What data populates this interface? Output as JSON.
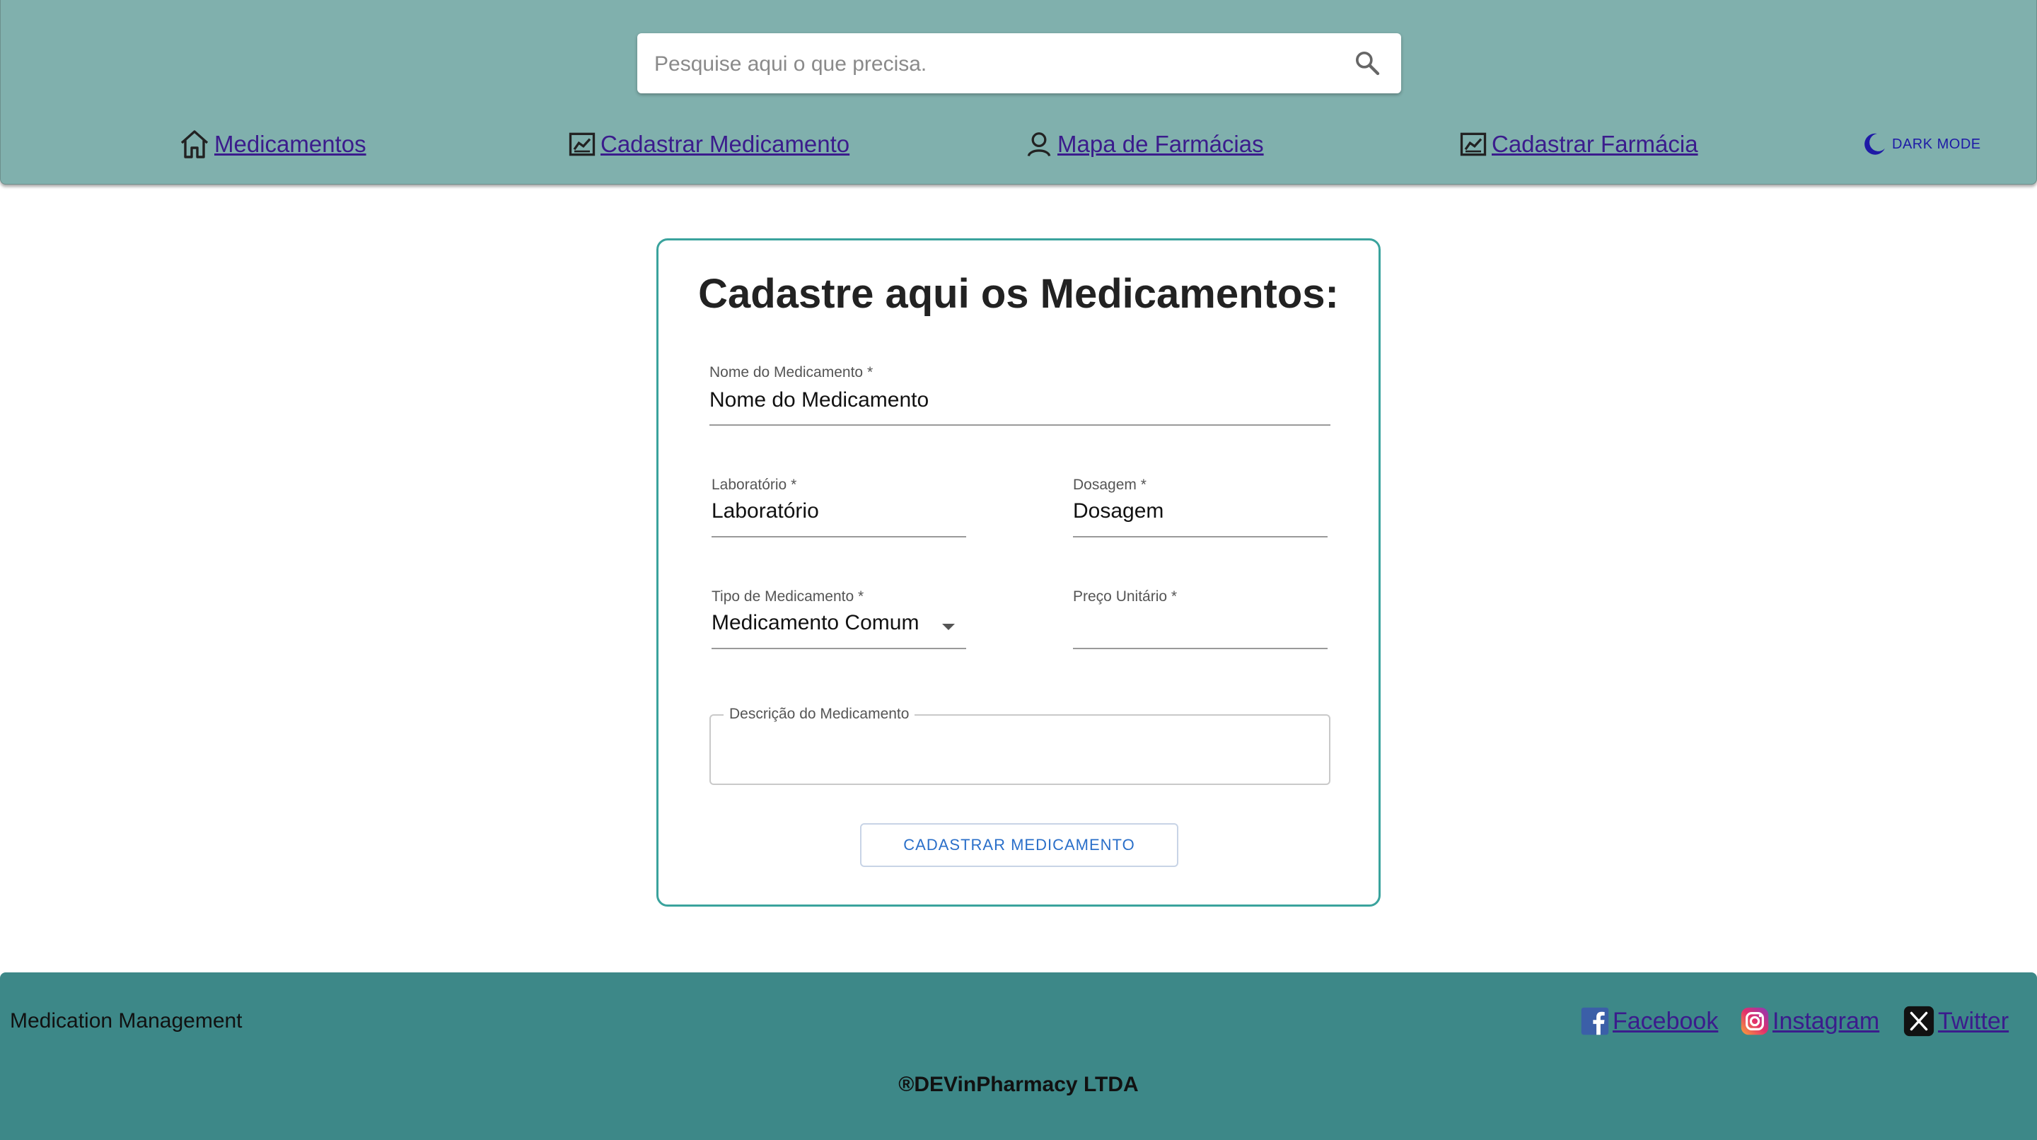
{
  "header": {
    "search": {
      "placeholder": "Pesquise aqui o que precisa.",
      "value": ""
    },
    "nav": [
      {
        "label": "Medicamentos",
        "icon": "home-icon"
      },
      {
        "label": "Cadastrar Medicamento",
        "icon": "chart-icon"
      },
      {
        "label": "Mapa de Farmácias",
        "icon": "user-icon"
      },
      {
        "label": "Cadastrar Farmácia",
        "icon": "chart-icon"
      }
    ],
    "dark_mode_label": "DARK MODE",
    "colors": {
      "bg": "#80b0ad",
      "link": "#3b1c8c",
      "dark_mode": "#1e1aa6"
    }
  },
  "form": {
    "title": "Cadastre aqui os Medicamentos:",
    "name": {
      "label": "Nome do Medicamento",
      "required": "*",
      "value": "Nome do Medicamento"
    },
    "lab": {
      "label": "Laboratório",
      "required": "*",
      "value": "Laboratório"
    },
    "dosage": {
      "label": "Dosagem",
      "required": "*",
      "value": "Dosagem"
    },
    "type": {
      "label": "Tipo de Medicamento",
      "required": "*",
      "value": "Medicamento Comum"
    },
    "price": {
      "label": "Preço Unitário",
      "required": "*",
      "value": ""
    },
    "description": {
      "label": "Descrição do Medicamento",
      "value": ""
    },
    "submit_label": "CADASTRAR MEDICAMENTO",
    "colors": {
      "border": "#3aa39d",
      "button_text": "#2a6fc9"
    }
  },
  "footer": {
    "brand": "Medication Management",
    "social": [
      {
        "label": "Facebook",
        "icon": "facebook-icon"
      },
      {
        "label": "Instagram",
        "icon": "instagram-icon"
      },
      {
        "label": "Twitter",
        "icon": "x-twitter-icon"
      }
    ],
    "copyright": "®DEVinPharmacy LTDA",
    "colors": {
      "bg": "#3d8888"
    }
  }
}
